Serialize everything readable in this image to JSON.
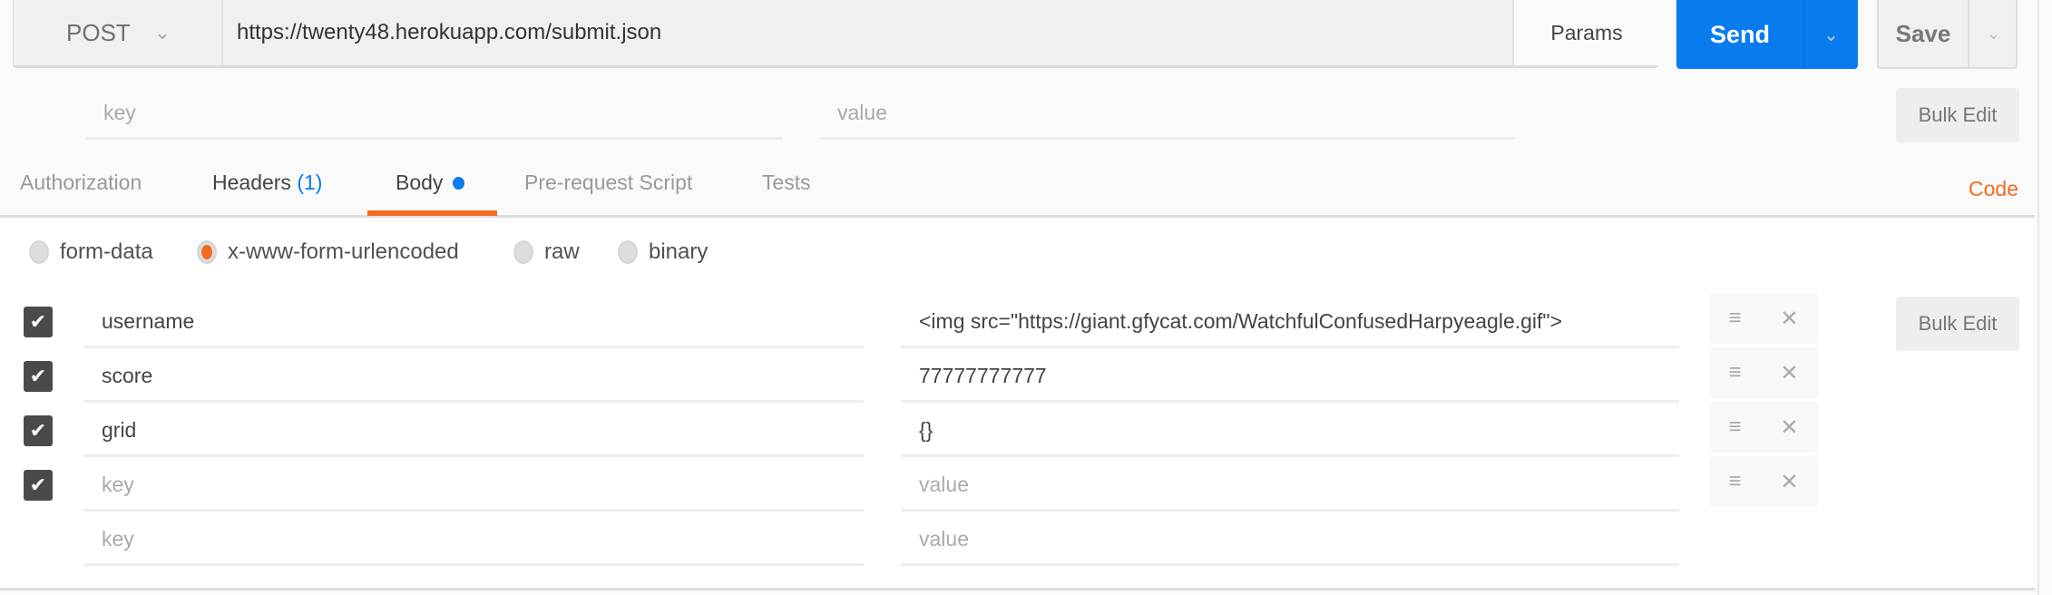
{
  "request": {
    "method": "POST",
    "url": "https://twenty48.herokuapp.com/submit.json",
    "params_label": "Params",
    "send_label": "Send",
    "save_label": "Save"
  },
  "params_editor": {
    "key_placeholder": "key",
    "value_placeholder": "value",
    "bulk_edit_label": "Bulk Edit"
  },
  "tabs": [
    {
      "label": "Authorization"
    },
    {
      "label": "Headers",
      "count": "(1)"
    },
    {
      "label": "Body",
      "active": true
    },
    {
      "label": "Pre-request Script"
    },
    {
      "label": "Tests"
    }
  ],
  "code_label": "Code",
  "body_modes": [
    {
      "label": "form-data",
      "selected": false
    },
    {
      "label": "x-www-form-urlencoded",
      "selected": true
    },
    {
      "label": "raw",
      "selected": false
    },
    {
      "label": "binary",
      "selected": false
    }
  ],
  "body_rows": [
    {
      "key": "username",
      "value": "<img src=\"https://giant.gfycat.com/WatchfulConfusedHarpyeagle.gif\">",
      "checked": true
    },
    {
      "key": "score",
      "value": "77777777777",
      "checked": true
    },
    {
      "key": "grid",
      "value": "{}",
      "checked": true
    },
    {
      "key_placeholder": "key",
      "value_placeholder": "value",
      "checked": true
    },
    {
      "key_placeholder": "key",
      "value_placeholder": "value",
      "checked": false
    }
  ],
  "body_bulk_edit_label": "Bulk Edit",
  "colors": {
    "accent": "#f26b21",
    "send": "#097bed",
    "badge": "#097bed"
  }
}
